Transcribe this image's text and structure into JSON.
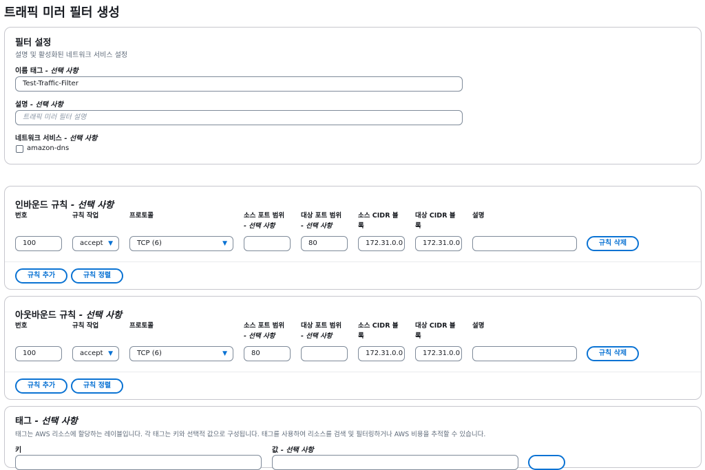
{
  "page": {
    "title": "트래픽 미러 필터 생성"
  },
  "settings": {
    "title": "필터 설정",
    "description": "설명 및 활성화된 네트워크 서비스 설정",
    "name_tag_label": "이름 태그",
    "optional_suffix": "- 선택 사항",
    "name_tag_value": "Test-Traffic-Filter",
    "description_label": "설명",
    "description_placeholder": "트래픽 미러 필터 설명",
    "network_service_label": "네트워크 서비스",
    "network_service_option": "amazon-dns"
  },
  "columns": {
    "number": "번호",
    "action": "규칙 작업",
    "protocol": "프로토콜",
    "src_port": "소스 포트 범위",
    "dst_port": "대상 포트 범위",
    "optional": "- 선택 사항",
    "src_cidr_a": "소스",
    "src_cidr_b": "CIDR 블",
    "dst_cidr_a": "대상",
    "dst_cidr_b": "CIDR 블",
    "cidr_tail": "록",
    "desc": "설명"
  },
  "inbound": {
    "title": "인바운드 규칙",
    "optional": "- 선택 사항",
    "rule": {
      "number": "100",
      "action": "accept",
      "protocol": "TCP (6)",
      "src_port": "",
      "dst_port": "80",
      "src_cidr": "172.31.0.0",
      "dst_cidr": "172.31.0.0",
      "description": ""
    },
    "delete_label": "규칙 삭제",
    "add_label": "규칙 추가",
    "sort_label": "규칙 정렬"
  },
  "outbound": {
    "title": "아웃바운드 규칙",
    "optional": "- 선택 사항",
    "rule": {
      "number": "100",
      "action": "accept",
      "protocol": "TCP (6)",
      "src_port": "80",
      "dst_port": "",
      "src_cidr": "172.31.0.0",
      "dst_cidr": "172.31.0.0",
      "description": ""
    },
    "delete_label": "규칙 삭제",
    "add_label": "규칙 추가",
    "sort_label": "규칙 정렬"
  },
  "tags": {
    "title": "태그",
    "optional": "- 선택 사항",
    "description": "태그는 AWS 리소스에 할당하는 레이블입니다. 각 태그는 키와 선택적 값으로 구성됩니다. 태그를 사용하여 리소스를 검색 및 필터링하거나 AWS 비용을 추적할 수 있습니다.",
    "key_label": "키",
    "value_label": "값",
    "value_optional": "- 선택 사항"
  },
  "icons": {
    "caret": "caret-down-icon"
  },
  "colors": {
    "accent": "#0972d3",
    "border": "#c6c6cd"
  }
}
